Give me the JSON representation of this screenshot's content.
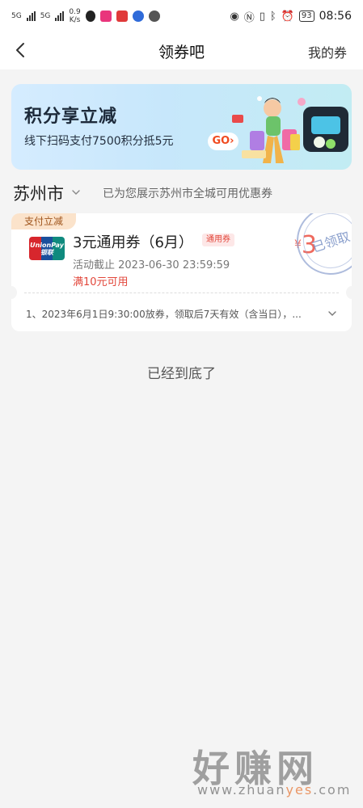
{
  "status_bar": {
    "sim1": "5G",
    "sim2": "5G",
    "speed_value": "0.9",
    "speed_unit": "K/s",
    "battery": "93",
    "time": "08:56"
  },
  "nav": {
    "title": "领券吧",
    "my_coupons": "我的券"
  },
  "banner": {
    "title": "积分享立减",
    "subtitle": "线下扫码支付7500积分抵5元",
    "go_label": "GO›"
  },
  "city": {
    "name": "苏州市",
    "note": "已为您展示苏州市全城可用优惠券"
  },
  "coupon": {
    "tag": "支付立减",
    "logo_text_top": "UnionPay",
    "logo_text_bottom": "银联",
    "name": "3元通用券（6月）",
    "type_badge": "通用券",
    "deadline": "活动截止 2023-06-30 23:59:59",
    "condition": "满10元可用",
    "currency": "¥",
    "amount": "3",
    "stamp": "已领取",
    "rule": "1、2023年6月1日9:30:00放券，领取后7天有效（含当日），..."
  },
  "footer": {
    "end_text": "已经到底了"
  },
  "watermark": {
    "text": "好赚网",
    "url_prefix": "www.zhuan",
    "url_highlight": "yes",
    "url_suffix": ".com"
  },
  "colors": {
    "accent_red": "#e2473b",
    "go_orange": "#f04a1f",
    "tag_bg": "#fbe3cb"
  }
}
